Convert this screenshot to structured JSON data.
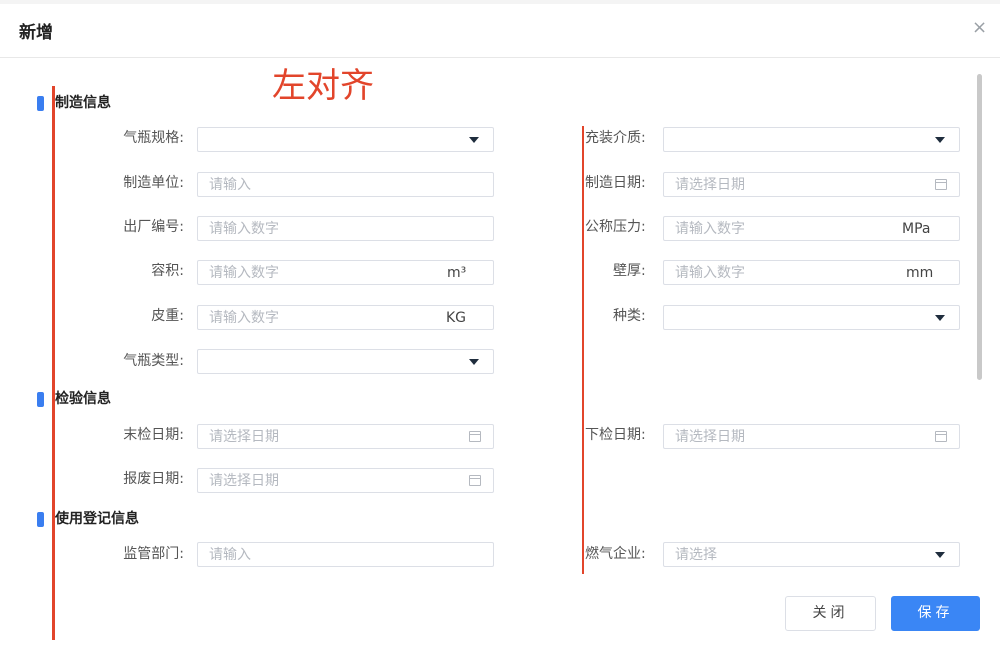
{
  "dialog": {
    "title": "新增",
    "close_icon": "×"
  },
  "annotation": {
    "text": "左对齐",
    "color": "#e2452b"
  },
  "sections": {
    "manufacture": "制造信息",
    "inspection": "检验信息",
    "registration": "使用登记信息"
  },
  "fields": {
    "cylinder_spec": {
      "label": "气瓶规格:",
      "value": ""
    },
    "fill_medium": {
      "label": "充装介质:",
      "value": ""
    },
    "manufacturer": {
      "label": "制造单位:",
      "placeholder": "请输入"
    },
    "manufacture_date": {
      "label": "制造日期:",
      "placeholder": "请选择日期"
    },
    "serial_no": {
      "label": "出厂编号:",
      "placeholder": "请输入数字"
    },
    "nominal_pressure": {
      "label": "公称压力:",
      "placeholder": "请输入数字",
      "unit": "MPa"
    },
    "volume": {
      "label": "容积:",
      "placeholder": "请输入数字",
      "unit": "m³"
    },
    "wall_thickness": {
      "label": "壁厚:",
      "placeholder": "请输入数字",
      "unit": "mm"
    },
    "tare_weight": {
      "label": "皮重:",
      "placeholder": "请输入数字",
      "unit": "KG"
    },
    "kind": {
      "label": "种类:",
      "value": ""
    },
    "cylinder_type": {
      "label": "气瓶类型:",
      "value": ""
    },
    "last_inspection": {
      "label": "末检日期:",
      "placeholder": "请选择日期"
    },
    "next_inspection": {
      "label": "下检日期:",
      "placeholder": "请选择日期"
    },
    "scrap_date": {
      "label": "报废日期:",
      "placeholder": "请选择日期"
    },
    "supervisor": {
      "label": "监管部门:",
      "placeholder": "请输入"
    },
    "gas_company": {
      "label": "燃气企业:",
      "placeholder": "请选择"
    }
  },
  "buttons": {
    "close": "关闭",
    "save": "保存"
  },
  "colors": {
    "accent": "#3a86f5",
    "section_marker": "#3a7ef0"
  }
}
